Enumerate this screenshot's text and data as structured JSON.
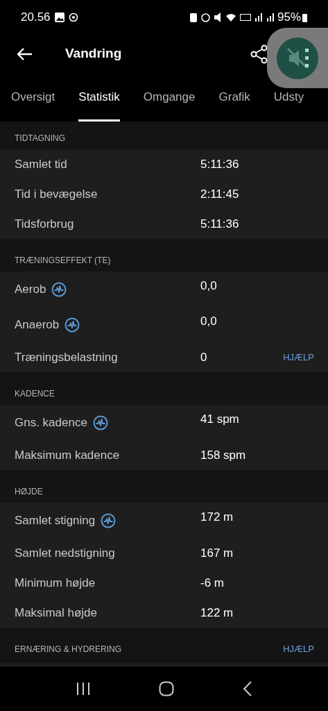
{
  "status_bar": {
    "time": "20.56",
    "battery": "95%"
  },
  "header": {
    "title": "Vandring"
  },
  "tabs": [
    {
      "label": "Oversigt",
      "selected": false
    },
    {
      "label": "Statistik",
      "selected": true
    },
    {
      "label": "Omgange",
      "selected": false
    },
    {
      "label": "Grafik",
      "selected": false
    },
    {
      "label": "Udsty",
      "selected": false
    }
  ],
  "sections": [
    {
      "title": "TIDTAGNING",
      "rows": [
        {
          "label": "Samlet tid",
          "value": "5:11:36",
          "info": false
        },
        {
          "label": "Tid i bevægelse",
          "value": "2:11:45",
          "info": false
        },
        {
          "label": "Tidsforbrug",
          "value": "5:11:36",
          "info": false
        }
      ]
    },
    {
      "title": "TRÆNINGSEFFEKT (TE)",
      "rows": [
        {
          "label": "Aerob",
          "value": "0,0",
          "info": true
        },
        {
          "label": "Anaerob",
          "value": "0,0",
          "info": true
        },
        {
          "label": "Træningsbelastning",
          "value": "0",
          "info": false,
          "help": "HJÆLP"
        }
      ]
    },
    {
      "title": "KADENCE",
      "rows": [
        {
          "label": "Gns. kadence",
          "value": "41 spm",
          "info": true
        },
        {
          "label": "Maksimum kadence",
          "value": "158 spm",
          "info": false
        }
      ]
    },
    {
      "title": "HØJDE",
      "rows": [
        {
          "label": "Samlet stigning",
          "value": "172 m",
          "info": true
        },
        {
          "label": "Samlet nedstigning",
          "value": "167 m",
          "info": false
        },
        {
          "label": "Minimum højde",
          "value": "-6 m",
          "info": false
        },
        {
          "label": "Maksimal højde",
          "value": "122 m",
          "info": false
        }
      ]
    },
    {
      "title": "ERNÆRING & HYDRERING",
      "help": "HJÆLP"
    }
  ]
}
